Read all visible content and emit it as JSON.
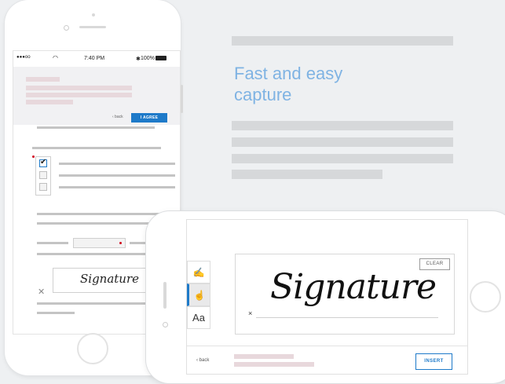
{
  "hero": {
    "title_line1": "Fast and easy",
    "title_line2": "capture"
  },
  "phone_portrait": {
    "status": {
      "signal": "●●●oo",
      "wifi": "wifi-icon",
      "time": "7:40 PM",
      "bluetooth": "bluetooth-icon",
      "battery_text": "100%"
    },
    "back_label": "‹ back",
    "agree_label": "I AGREE",
    "checkboxes": [
      {
        "checked": true
      },
      {
        "checked": false
      },
      {
        "checked": false
      }
    ],
    "signature_preview": "Signature",
    "accent_color": "#1e7ac9",
    "required_color": "#d0021b"
  },
  "phone_landscape": {
    "tools": [
      {
        "name": "draw-tool",
        "icon": "pen-draw-icon",
        "glyph": "✍"
      },
      {
        "name": "upload-tool",
        "icon": "hand-icon",
        "glyph": "☝"
      },
      {
        "name": "type-tool",
        "icon": "type-icon",
        "glyph": "Aa"
      }
    ],
    "active_tool": "upload-tool",
    "clear_label": "CLEAR",
    "signature_text": "Signature",
    "x_mark": "×",
    "back_label": "‹ back",
    "insert_label": "INSERT"
  }
}
